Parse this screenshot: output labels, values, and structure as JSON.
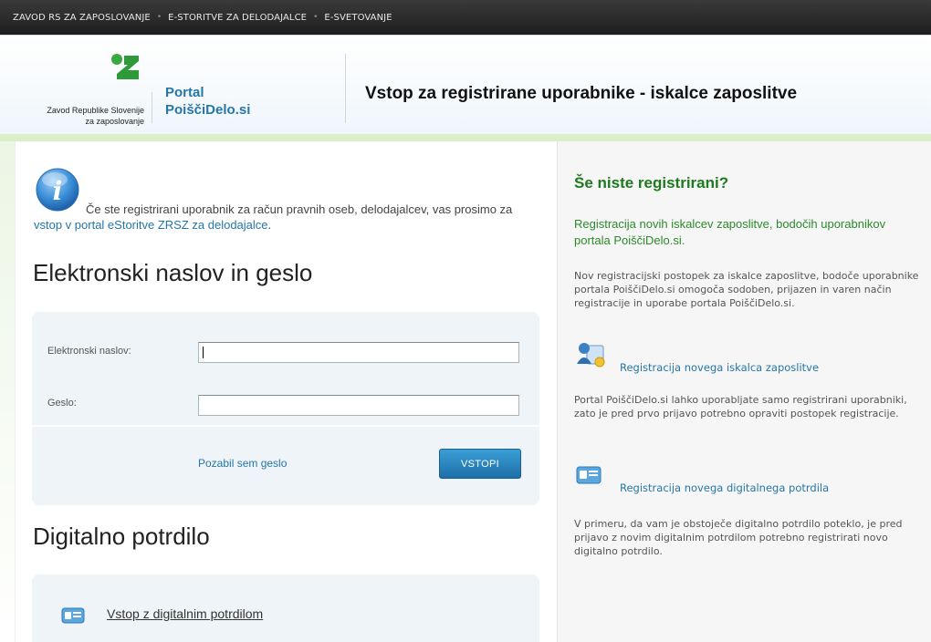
{
  "topnav": {
    "items": [
      "ZAVOD RS ZA ZAPOSLOVANJE",
      "E-STORITVE ZA DELODAJALCE",
      "E-SVETOVANJE"
    ],
    "separator": "•"
  },
  "header": {
    "logo_line1": "Zavod Republike Slovenije",
    "logo_line2": "za zaposlovanje",
    "portal_line1": "Portal",
    "portal_line2": "PoiščiDelo.si",
    "title": "Vstop za registrirane uporabnike - iskalce zaposlitve"
  },
  "info": {
    "text_before": "Če ste registrirani uporabnik za račun pravnih oseb, delodajalcev, vas prosimo za ",
    "link": "vstop v portal eStoritve ZRSZ za delodajalce",
    "text_after": "."
  },
  "login": {
    "heading": "Elektronski naslov in geslo",
    "email_label": "Elektronski naslov:",
    "email_value": "",
    "password_label": "Geslo:",
    "password_value": "",
    "forgot": "Pozabil sem geslo",
    "submit": "VSTOPI"
  },
  "cert": {
    "heading": "Digitalno potrdilo",
    "link": "Vstop z digitalnim potrdilom"
  },
  "sidebar": {
    "title": "Še niste registrirani?",
    "lead": "Registracija novih iskalcev zaposlitve, bodočih uporabnikov portala PoiščiDelo.si.",
    "para1": "Nov registracijski postopek za iskalce zaposlitve, bodoče uporabnike portala PoiščiDelo.si omogoča sodoben, prijazen in varen način registracije in uporabe portala PoiščiDelo.si.",
    "link1": "Registracija novega iskalca zaposlitve",
    "para2": "Portal PoiščiDelo.si lahko uporabljate samo registrirani uporabniki, zato je pred prvo prijavo potrebno opraviti postopek registracije.",
    "link2": "Registracija novega digitalnega potrdila",
    "para3": "V primeru, da vam je obstoječe digitalno potrdilo poteklo, je pred prijavo z novim digitalnim potrdilom potrebno registrirati novo digitalno potrdilo."
  },
  "colors": {
    "brand_green": "#2e9a3a",
    "link_blue": "#2576a9",
    "button_blue": "#1e6fa8",
    "sidebar_title_green": "#1d7a1d"
  },
  "icons": {
    "info": "info-icon",
    "logo": "zrsz-logo-icon",
    "user_register": "user-register-icon",
    "cert_card": "id-card-icon"
  }
}
